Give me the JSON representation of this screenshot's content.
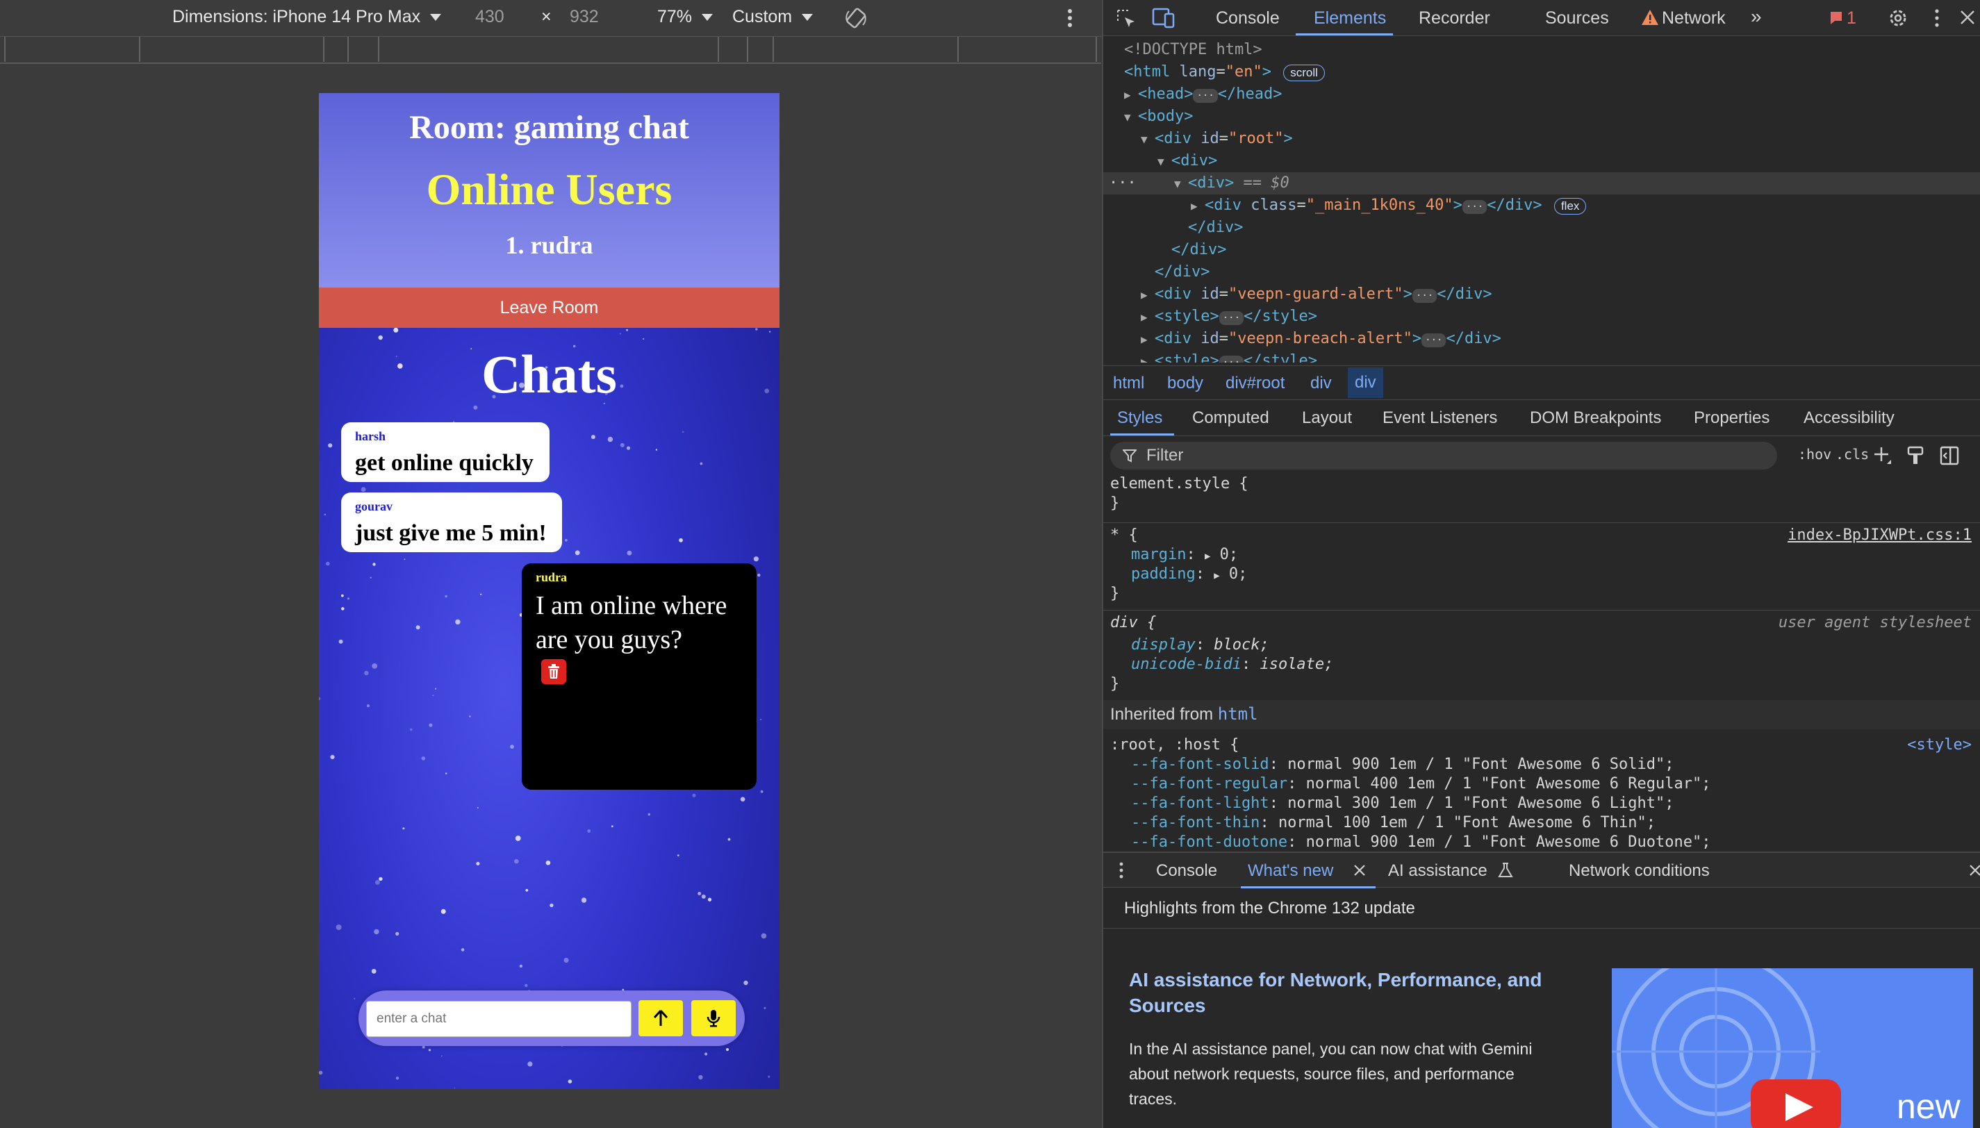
{
  "device_toolbar": {
    "dimensions_label": "Dimensions: iPhone 14 Pro Max",
    "width": "430",
    "times": "×",
    "height": "932",
    "zoom": "77%",
    "throttle": "Custom"
  },
  "phone": {
    "room_title": "Room: gaming chat",
    "online_heading": "Online Users",
    "online_users": [
      "1. rudra"
    ],
    "leave_button": "Leave Room",
    "chats_title": "Chats",
    "messages": [
      {
        "sender": "harsh",
        "text": "get online quickly",
        "mine": false
      },
      {
        "sender": "gourav",
        "text": "just give me 5 min!",
        "mine": false
      },
      {
        "sender": "rudra",
        "text": "I am online where are you guys?",
        "mine": true
      }
    ],
    "input_placeholder": "enter a chat",
    "colors": {
      "header_top": "#5d62d8",
      "leave": "#d2574a",
      "accent_yellow": "#fbfb4a",
      "send_button": "#fbf01e"
    }
  },
  "devtools": {
    "tabs": [
      "Console",
      "Elements",
      "Recorder",
      "Sources",
      "Network"
    ],
    "active_tab": "Elements",
    "error_count": "1",
    "dom": {
      "doctype": "<!DOCTYPE html>",
      "html_lang": "en",
      "scroll_chip": "scroll",
      "selected_marker": "== $0",
      "main_class": "_main_1k0ns_40",
      "flex_chip": "flex",
      "root_id": "root",
      "guard_id": "veepn-guard-alert",
      "breach_id": "veepn-breach-alert"
    },
    "breadcrumb": [
      "html",
      "body",
      "div#root",
      "div",
      "div"
    ],
    "sub_tabs": [
      "Styles",
      "Computed",
      "Layout",
      "Event Listeners",
      "DOM Breakpoints",
      "Properties",
      "Accessibility"
    ],
    "filter_placeholder": "Filter",
    "filter_options": [
      ":hov",
      ".cls"
    ],
    "styles": {
      "element_style": "element.style {",
      "universal_source": "index-BpJIXWPt.css:1",
      "margin": "0;",
      "padding": "0;",
      "ua_label": "user agent stylesheet",
      "display": "block;",
      "unicode_bidi": "isolate;",
      "inherited_label": "Inherited from",
      "inherited_tag": "html",
      "root_selector": ":root, :host {",
      "root_source": "<style>",
      "fa_vars": [
        {
          "name": "--fa-font-solid",
          "value": "normal 900 1em / 1 \"Font Awesome 6 Solid\";"
        },
        {
          "name": "--fa-font-regular",
          "value": "normal 400 1em / 1 \"Font Awesome 6 Regular\";"
        },
        {
          "name": "--fa-font-light",
          "value": "normal 300 1em / 1 \"Font Awesome 6 Light\";"
        },
        {
          "name": "--fa-font-thin",
          "value": "normal 100 1em / 1 \"Font Awesome 6 Thin\";"
        },
        {
          "name": "--fa-font-duotone",
          "value": "normal 900 1em / 1 \"Font Awesome 6 Duotone\";"
        }
      ]
    },
    "drawer": {
      "tabs": [
        "Console",
        "What's new",
        "AI assistance",
        "Network conditions"
      ],
      "highlight": "Highlights from the Chrome 132 update",
      "feature_title": "AI assistance for Network, Performance, and Sources",
      "feature_text": "In the AI assistance panel, you can now chat with Gemini about network requests, source files, and performance traces.",
      "image_badge": "new"
    }
  }
}
